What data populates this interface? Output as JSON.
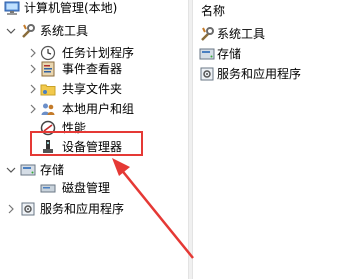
{
  "tree": {
    "root": "计算机管理(本地)",
    "items": [
      {
        "label": "系统工具",
        "icon": "tools-icon",
        "expanded": true
      },
      {
        "label": "任务计划程序",
        "icon": "clock-icon"
      },
      {
        "label": "事件查看器",
        "icon": "event-viewer-icon"
      },
      {
        "label": "共享文件夹",
        "icon": "shared-folder-icon"
      },
      {
        "label": "本地用户和组",
        "icon": "users-icon"
      },
      {
        "label": "性能",
        "icon": "performance-icon"
      },
      {
        "label": "设备管理器",
        "icon": "device-manager-icon"
      },
      {
        "label": "存储",
        "icon": "storage-icon",
        "expanded": true
      },
      {
        "label": "磁盘管理",
        "icon": "disk-icon"
      },
      {
        "label": "服务和应用程序",
        "icon": "services-icon"
      }
    ]
  },
  "right_pane": {
    "column_header": "名称",
    "items": [
      {
        "label": "系统工具",
        "icon": "tools-icon"
      },
      {
        "label": "存储",
        "icon": "storage-icon"
      },
      {
        "label": "服务和应用程序",
        "icon": "services-icon"
      }
    ]
  },
  "annotation": {
    "color": "#e53935"
  }
}
